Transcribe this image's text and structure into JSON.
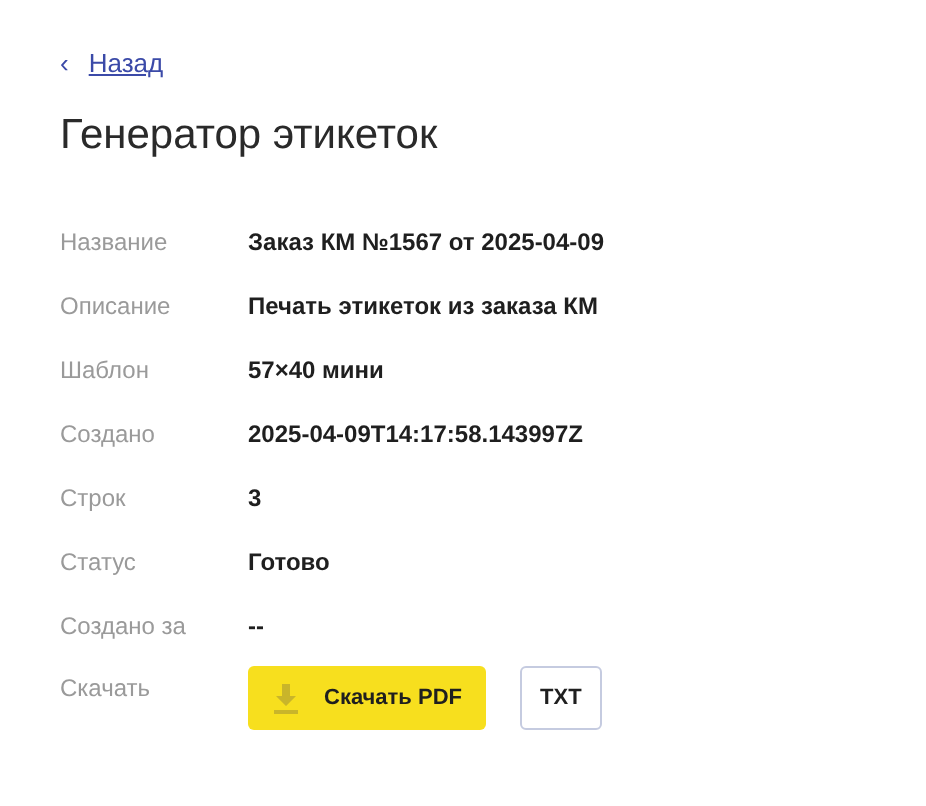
{
  "back_link": {
    "icon": "‹",
    "label": "Назад"
  },
  "title": "Генератор этикеток",
  "fields": [
    {
      "label": "Название",
      "value": "Заказ КМ №1567 от 2025-04-09"
    },
    {
      "label": "Описание",
      "value": "Печать этикеток из заказа КМ"
    },
    {
      "label": "Шаблон",
      "value": "57×40 мини"
    },
    {
      "label": "Создано",
      "value": "2025-04-09T14:17:58.143997Z"
    },
    {
      "label": "Строк",
      "value": "3"
    },
    {
      "label": "Статус",
      "value": "Готово"
    },
    {
      "label": "Создано за",
      "value": "--"
    }
  ],
  "download": {
    "label": "Скачать",
    "buttons": [
      {
        "kind": "primary",
        "label": "Скачать PDF"
      },
      {
        "kind": "outline",
        "label": "TXT"
      }
    ]
  }
}
